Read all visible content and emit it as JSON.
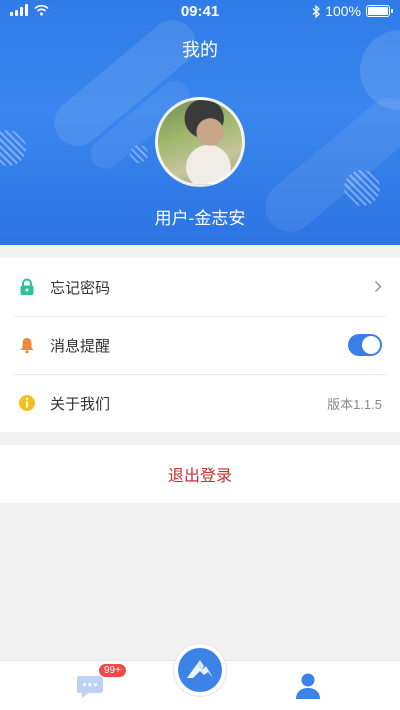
{
  "status_bar": {
    "time": "09:41",
    "battery_text": "100%",
    "battery_level": 1.0,
    "signal_icon": "signal-bars-icon",
    "wifi_icon": "wifi-icon",
    "bluetooth_icon": "bluetooth-icon"
  },
  "header": {
    "title": "我的",
    "username": "用户-金志安",
    "gradient_colors": [
      "#2f7be8",
      "#3a86ee"
    ]
  },
  "menu": {
    "items": [
      {
        "label": "忘记密码",
        "icon": "lock-icon",
        "icon_color": "#2cc29a",
        "trailing": "chevron-right-icon"
      },
      {
        "label": "消息提醒",
        "icon": "bell-icon",
        "icon_color": "#f0893a",
        "trailing": "toggle",
        "toggle_on": true
      },
      {
        "label": "关于我们",
        "icon": "info-icon",
        "icon_color": "#f3c01b",
        "trailing_text": "版本1.1.5"
      }
    ]
  },
  "logout": {
    "label": "退出登录",
    "color": "#c9302c"
  },
  "tabbar": {
    "tabs": [
      {
        "name": "messages",
        "icon": "chat-icon",
        "badge": "99+"
      },
      {
        "name": "home",
        "icon": "mountain-logo-icon"
      },
      {
        "name": "me",
        "icon": "user-icon",
        "active": true
      }
    ],
    "accent": "#3d82e6"
  }
}
